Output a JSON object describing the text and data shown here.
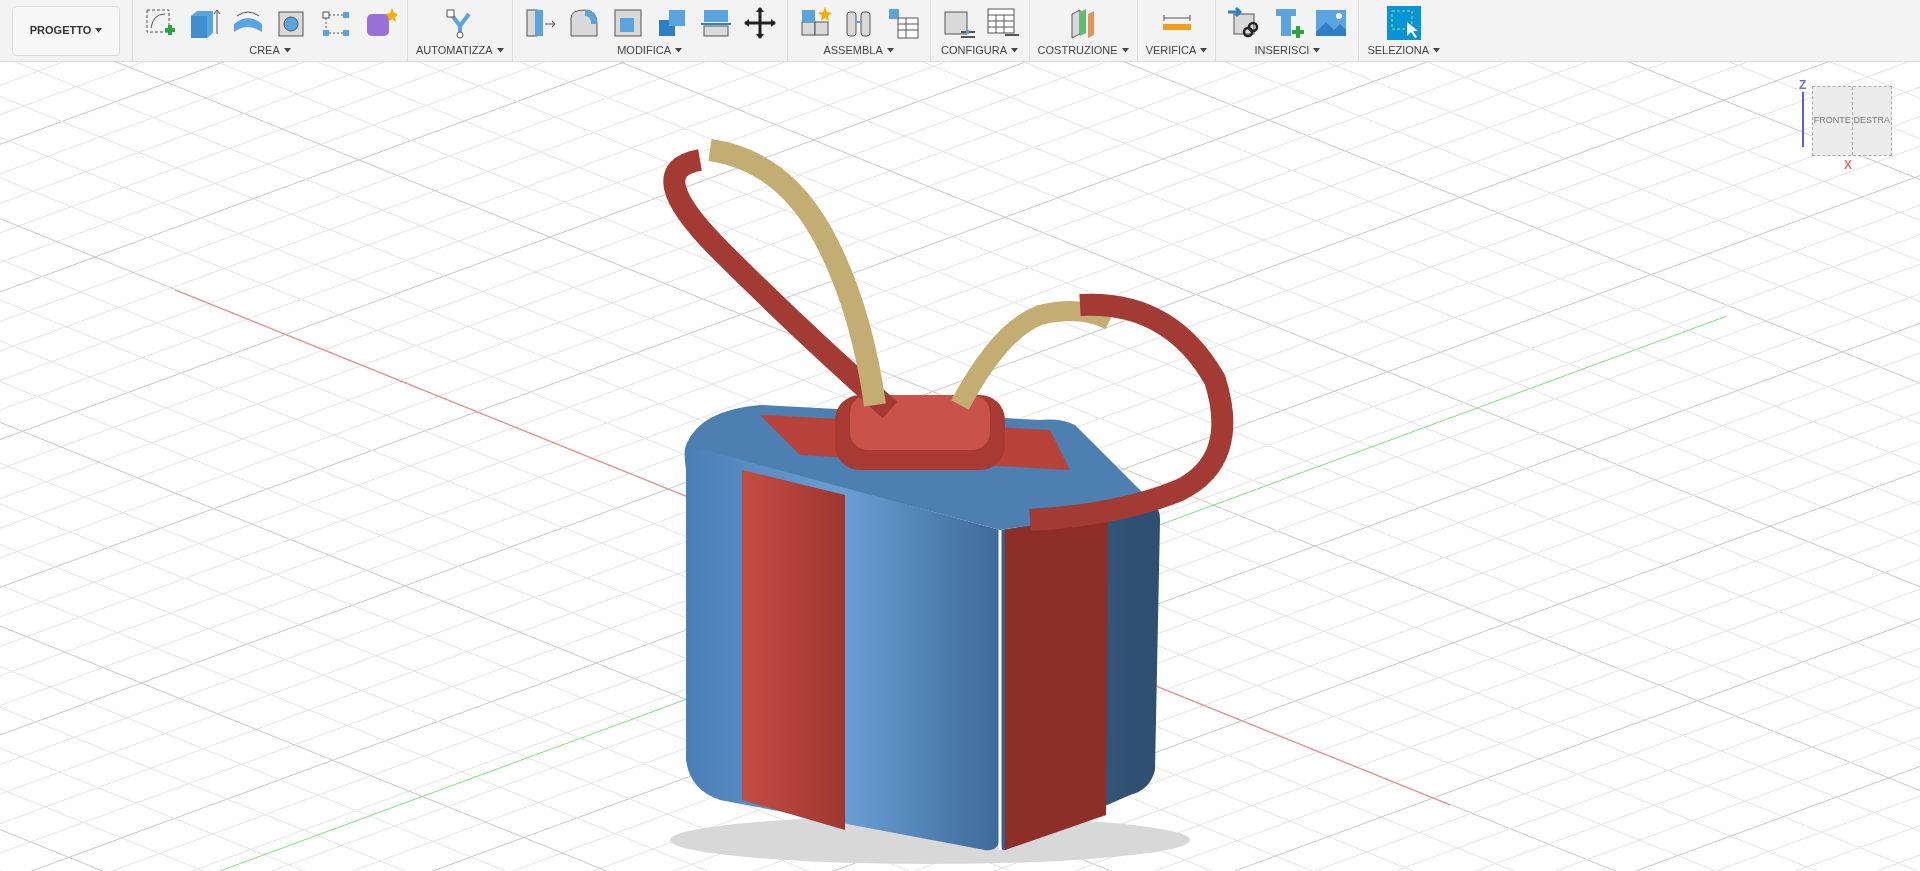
{
  "project_menu": {
    "label": "PROGETTO"
  },
  "toolbar_groups": [
    {
      "label": "CREA",
      "tools": [
        {
          "kind": "sketch"
        },
        {
          "kind": "extrude"
        },
        {
          "kind": "revolve"
        },
        {
          "kind": "hole"
        },
        {
          "kind": "pattern"
        },
        {
          "kind": "form"
        }
      ]
    },
    {
      "label": "AUTOMATIZZA",
      "tools": [
        {
          "kind": "automate"
        }
      ]
    },
    {
      "label": "MODIFICA",
      "tools": [
        {
          "kind": "presspull"
        },
        {
          "kind": "fillet"
        },
        {
          "kind": "shell"
        },
        {
          "kind": "combine"
        },
        {
          "kind": "split"
        },
        {
          "kind": "move"
        }
      ]
    },
    {
      "label": "ASSEMBLA",
      "tools": [
        {
          "kind": "component"
        },
        {
          "kind": "joint"
        },
        {
          "kind": "table"
        }
      ]
    },
    {
      "label": "CONFIGURA",
      "tools": [
        {
          "kind": "config"
        },
        {
          "kind": "configtable"
        }
      ]
    },
    {
      "label": "COSTRUZIONE",
      "tools": [
        {
          "kind": "plane"
        }
      ]
    },
    {
      "label": "VERIFICA",
      "tools": [
        {
          "kind": "measure"
        }
      ]
    },
    {
      "label": "INSERISCI",
      "tools": [
        {
          "kind": "insertlink"
        },
        {
          "kind": "bolt"
        },
        {
          "kind": "image"
        }
      ]
    },
    {
      "label": "SELEZIONA",
      "tools": [
        {
          "kind": "select"
        }
      ]
    }
  ],
  "view_cube": {
    "front": "FRONTE",
    "right": "DESTRA",
    "axis_z": "Z",
    "axis_x": "X"
  }
}
